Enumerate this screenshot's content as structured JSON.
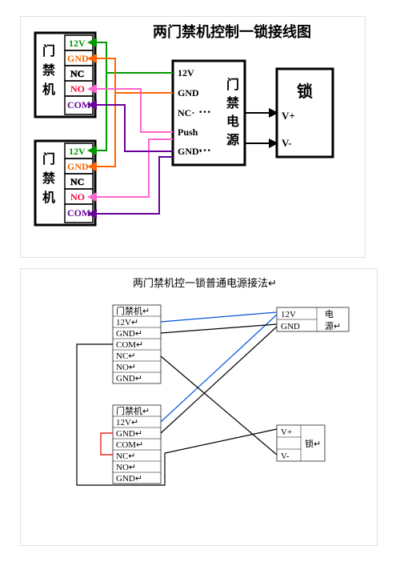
{
  "diagram1": {
    "title": "两门禁机控制一锁接线图",
    "reader_label_vertical": "门禁机",
    "reader_pins": [
      "12V",
      "GND",
      "NC",
      "NO",
      "COM"
    ],
    "psu_label_vertical": "门禁电源",
    "psu_pins": [
      "12V",
      "GND",
      "NC",
      "Push",
      "GND"
    ],
    "psu_outputs": [
      "···",
      "···"
    ],
    "lock_label": "锁",
    "lock_pins": [
      "V+",
      "V-"
    ]
  },
  "diagram2": {
    "title": "两门禁机控一锁普通电源接法↵",
    "reader_label": "门禁机↵",
    "reader_pins": [
      "12V↵",
      "GND↵",
      "COM↵",
      "NC↵",
      "NO↵",
      "GND↵"
    ],
    "psu_pins": [
      "12V",
      "GND"
    ],
    "psu_label_vertical": "电源",
    "lock_pins": [
      "V+",
      "V-"
    ],
    "lock_label": "锁↵"
  }
}
